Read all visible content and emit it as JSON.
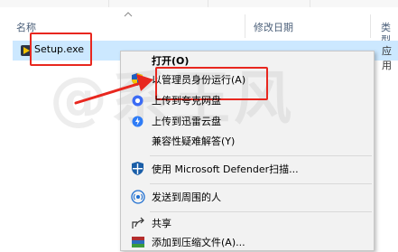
{
  "header": {
    "name_col": "名称",
    "date_col": "修改日期",
    "type_col": "类型"
  },
  "file": {
    "name": "Setup.exe",
    "type_partial": "应用"
  },
  "watermark": "@系王风",
  "menu": {
    "items": [
      {
        "label": "打开(O)",
        "icon": "none",
        "bold": true
      },
      {
        "label": "以管理员身份运行(A)",
        "icon": "uac-shield-icon"
      },
      {
        "label": "上传到夸克网盘",
        "icon": "quark-icon"
      },
      {
        "label": "上传到迅雷云盘",
        "icon": "thunder-cloud-icon"
      },
      {
        "label": "兼容性疑难解答(Y)",
        "icon": "none"
      },
      {
        "label": "使用 Microsoft Defender扫描...",
        "icon": "defender-icon"
      },
      {
        "label": "发送到周围的人",
        "icon": "nearby-share-icon"
      },
      {
        "label": "共享",
        "icon": "share-icon"
      },
      {
        "label": "添加到压缩文件(A)...",
        "icon": "archive-icon"
      }
    ]
  },
  "colors": {
    "selection": "#cce8ff",
    "highlight_red": "#e8271f",
    "menu_bg": "#f2f2f2"
  }
}
